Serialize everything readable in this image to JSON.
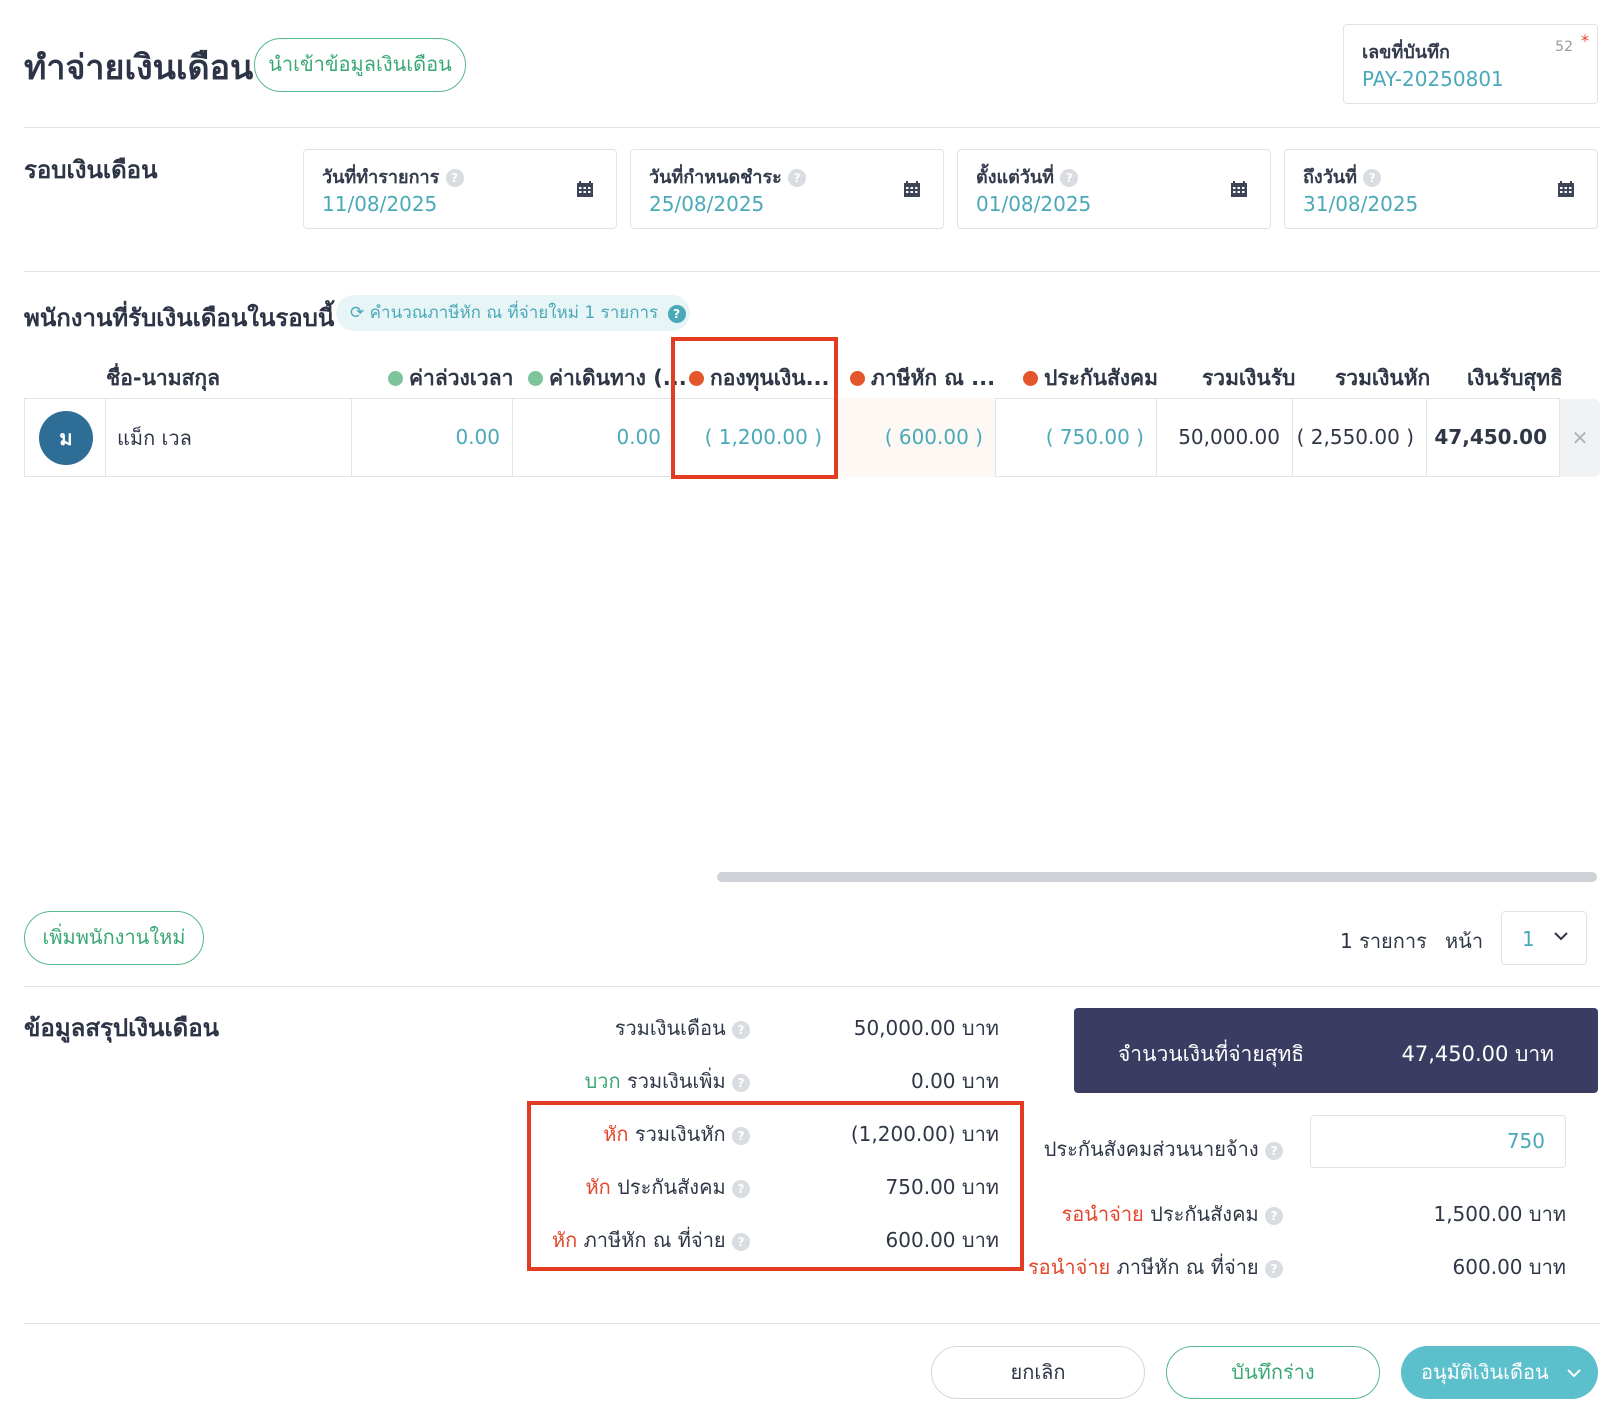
{
  "header": {
    "title": "ทำจ่ายเงินเดือน",
    "import_button": "นำเข้าข้อมูลเงินเดือน",
    "doc_number": {
      "label": "เลขที่บันทึก",
      "value": "PAY-20250801",
      "char_count": "52",
      "required_mark": "*"
    }
  },
  "payroll_round": {
    "title": "รอบเงินเดือน",
    "fields": [
      {
        "label": "วันที่ทำรายการ",
        "value": "11/08/2025"
      },
      {
        "label": "วันที่กำหนดชำระ",
        "value": "25/08/2025"
      },
      {
        "label": "ตั้งแต่วันที่",
        "value": "01/08/2025"
      },
      {
        "label": "ถึงวันที่",
        "value": "31/08/2025"
      }
    ]
  },
  "employees": {
    "title": "พนักงานที่รับเงินเดือนในรอบนี้",
    "recalc_label": "คำนวณภาษีหัก ณ ที่จ่ายใหม่ 1 รายการ",
    "recalc_help": "?",
    "columns": {
      "name": "ชื่อ-นามสกุล",
      "overtime": "ค่าล่วงเวลา",
      "travel": "ค่าเดินทาง (...",
      "fund": "กองทุนเงิน...",
      "tax": "ภาษีหัก ณ ...",
      "social": "ประกันสังคม",
      "total_income": "รวมเงินรับ",
      "total_deduct": "รวมเงินหัก",
      "net": "เงินรับสุทธิ"
    },
    "rows": [
      {
        "initial": "ม",
        "name": "แม็ก เวล",
        "overtime": "0.00",
        "travel": "0.00",
        "fund": "( 1,200.00 )",
        "tax": "( 600.00 )",
        "social": "( 750.00 )",
        "total_income": "50,000.00",
        "total_deduct": "( 2,550.00 )",
        "net": "47,450.00"
      }
    ],
    "add_button": "เพิ่มพนักงานใหม่",
    "pager": {
      "count": "1 รายการ",
      "page_label": "หน้า",
      "page": "1"
    }
  },
  "summary": {
    "title": "ข้อมูลสรุปเงินเดือน",
    "total_salary": {
      "label": "รวมเงินเดือน",
      "value": "50,000.00 บาท"
    },
    "add_extra": {
      "prefix": "บวก",
      "label": "รวมเงินเพิ่ม",
      "value": "0.00 บาท"
    },
    "deduct_total": {
      "prefix": "หัก",
      "label": "รวมเงินหัก",
      "value": "(1,200.00) บาท"
    },
    "deduct_social": {
      "prefix": "หัก",
      "label": "ประกันสังคม",
      "value": "750.00 บาท"
    },
    "deduct_tax": {
      "prefix": "หัก",
      "label": "ภาษีหัก ณ ที่จ่าย",
      "value": "600.00 บาท"
    },
    "net_pay": {
      "label": "จำนวนเงินที่จ่ายสุทธิ",
      "value": "47,450.00 บาท"
    },
    "employer_social": {
      "label": "ประกันสังคมส่วนนายจ้าง",
      "value": "750"
    },
    "pending_social": {
      "prefix": "รอนำจ่าย",
      "label": "ประกันสังคม",
      "value": "1,500.00 บาท"
    },
    "pending_tax": {
      "prefix": "รอนำจ่าย",
      "label": "ภาษีหัก ณ ที่จ่าย",
      "value": "600.00 บาท"
    }
  },
  "footer": {
    "cancel": "ยกเลิก",
    "save_draft": "บันทึกร่าง",
    "approve": "อนุมัติเงินเดือน"
  },
  "colors": {
    "accent_teal": "#4aa9b8",
    "green": "#3aa874",
    "red": "#e4462c",
    "navy": "#3a3d61",
    "highlight": "#e23d23"
  }
}
